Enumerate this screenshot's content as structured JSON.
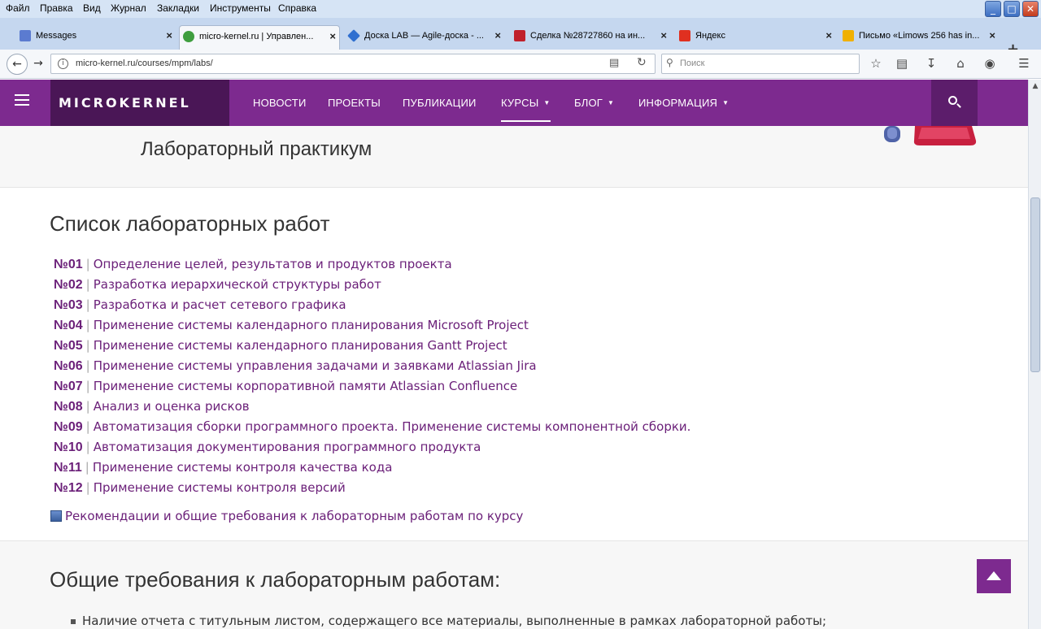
{
  "menubar": {
    "items": [
      "Файл",
      "Правка",
      "Вид",
      "Журнал",
      "Закладки",
      "Инструменты",
      "Справка"
    ]
  },
  "window_controls": {
    "minimize": "_",
    "maximize": "□",
    "close": "✕"
  },
  "tabs": [
    {
      "label": "Messages",
      "active": false,
      "icon_color": "#5b7bd0"
    },
    {
      "label": "micro-kernel.ru | Управлен...",
      "active": true,
      "icon_color": "#3f9e3f"
    },
    {
      "label": "Доска LAB — Agile-доска - ...",
      "active": false,
      "icon_color": "#2f6fd0"
    },
    {
      "label": "Сделка №28727860 на ин...",
      "active": false,
      "icon_color": "#c0202b"
    },
    {
      "label": "Яндекс",
      "active": false,
      "icon_color": "#e03020"
    },
    {
      "label": "Письмо «Limows 256 has in...",
      "active": false,
      "icon_color": "#f0b000"
    }
  ],
  "tab_close_glyph": "×",
  "newtab_glyph": "+",
  "address": {
    "url": "micro-kernel.ru/courses/mpm/labs/",
    "search_placeholder": "Поиск"
  },
  "site": {
    "logo": "MICROKERNEL",
    "nav": [
      {
        "label": "НОВОСТИ",
        "dropdown": false,
        "active": false
      },
      {
        "label": "ПРОЕКТЫ",
        "dropdown": false,
        "active": false
      },
      {
        "label": "ПУБЛИКАЦИИ",
        "dropdown": false,
        "active": false
      },
      {
        "label": "КУРСЫ",
        "dropdown": true,
        "active": true
      },
      {
        "label": "БЛОГ",
        "dropdown": true,
        "active": false
      },
      {
        "label": "ИНФОРМАЦИЯ",
        "dropdown": true,
        "active": false
      }
    ],
    "accent_color": "#7d2a8f"
  },
  "hero": {
    "title": "Лабораторный практикум"
  },
  "labs": {
    "heading": "Список лабораторных работ",
    "separator": "|",
    "items": [
      {
        "num": "№01",
        "title": "Определение целей, результатов и продуктов проекта"
      },
      {
        "num": "№02",
        "title": "Разработка иерархической структуры работ"
      },
      {
        "num": "№03",
        "title": "Разработка и расчет сетевого графика"
      },
      {
        "num": "№04",
        "title": "Применение системы календарного планирования Microsoft Project"
      },
      {
        "num": "№05",
        "title": "Применение системы календарного планирования Gantt Project"
      },
      {
        "num": "№06",
        "title": "Применение системы управления задачами и заявками Atlassian Jira"
      },
      {
        "num": "№07",
        "title": "Применение системы корпоративной памяти Atlassian Confluence"
      },
      {
        "num": "№08",
        "title": "Анализ и оценка рисков"
      },
      {
        "num": "№09",
        "title": "Автоматизация сборки программного проекта. Применение системы компонентной сборки."
      },
      {
        "num": "№10",
        "title": "Автоматизация документирования программного продукта"
      },
      {
        "num": "№11",
        "title": "Применение системы контроля качества кода"
      },
      {
        "num": "№12",
        "title": "Применение системы контроля версий"
      }
    ],
    "recommendations": "Рекомендации и общие требования к лабораторным работам по курсу"
  },
  "requirements": {
    "heading": "Общие требования к лабораторным работам:",
    "first_item": "Наличие отчета с титульным листом, содержащего все материалы, выполненные в рамках лабораторной работы;"
  }
}
